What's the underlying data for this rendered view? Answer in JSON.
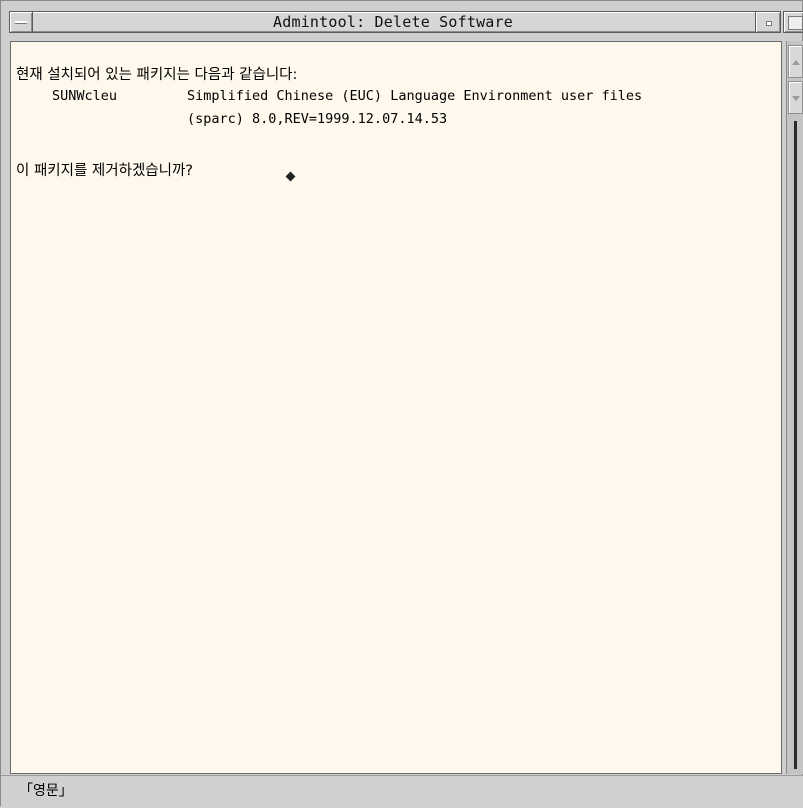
{
  "window": {
    "title": "Admintool: Delete Software"
  },
  "message": {
    "header": "현재 설치되어 있는 패키지는 다음과 같습니다:",
    "package_name": "SUNWcleu",
    "package_desc_line1": "Simplified Chinese (EUC) Language Environment user files",
    "package_desc_line2": "(sparc) 8.0,REV=1999.12.07.14.53",
    "question": "이 패키지를 제거하겠습니까?"
  },
  "statusbar": {
    "input_mode": "「영문」"
  },
  "icons": {
    "window_menu": "window-menu-icon",
    "minimize": "minimize-icon",
    "maximize": "maximize-icon",
    "scroll_up": "arrow-up-icon",
    "scroll_down": "arrow-down-icon",
    "cursor": "text-cursor-icon"
  },
  "colors": {
    "content_bg": "#fff8ec",
    "chrome": "#d6d6d6"
  }
}
